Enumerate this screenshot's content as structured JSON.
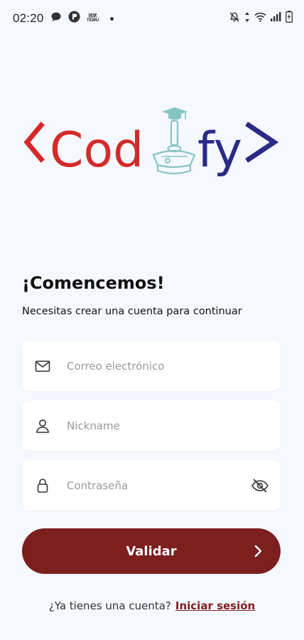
{
  "status_bar": {
    "time": "02:20",
    "temu_top": "冠状",
    "temu_bottom": "TEMU"
  },
  "logo": {
    "brand": "Codify",
    "text_left": "Cod",
    "text_right": "fy",
    "colors": {
      "red": "#d42a2a",
      "navy": "#2b2a87",
      "teal": "#86c4c2"
    }
  },
  "heading": "¡Comencemos!",
  "subheading": "Necesitas crear una cuenta para continuar",
  "form": {
    "email_placeholder": "Correo electrónico",
    "nickname_placeholder": "Nickname",
    "password_placeholder": "Contraseña"
  },
  "primary_button": {
    "label": "Validar",
    "color": "#7b1f1f"
  },
  "footer": {
    "prompt": "¿Ya tienes una cuenta?",
    "link": "Iniciar sesión"
  },
  "icons": [
    "chat-bubble-icon",
    "app-badge-icon",
    "notification-off-icon",
    "data-arrows-icon",
    "wifi-icon",
    "signal-icon",
    "battery-icon",
    "mail-icon",
    "user-icon",
    "lock-icon",
    "eye-off-icon",
    "chevron-right-icon"
  ]
}
